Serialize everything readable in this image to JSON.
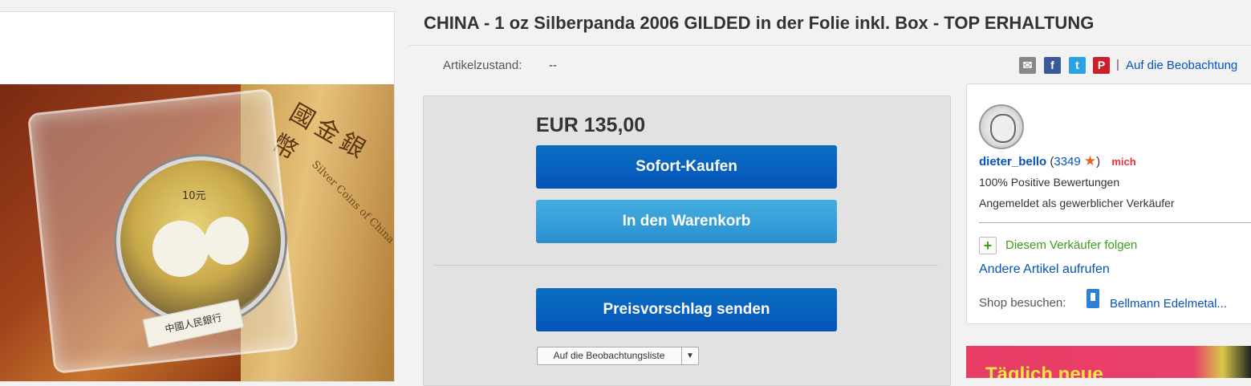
{
  "product": {
    "title": "CHINA - 1 oz Silberpanda 2006 GILDED in der Folie inkl. Box - TOP ERHALTUNG",
    "condition_label": "Artikelzustand:",
    "condition_value": "--",
    "image_box_chars": "國金銀幣",
    "image_box_sub": "Silver Coins of China",
    "image_coin_denom": "10元",
    "image_card_text": "中國人民銀行"
  },
  "share": {
    "separator": "|",
    "watchlist_link": "Auf die Beobachtung"
  },
  "buy_box": {
    "price": "EUR 135,00",
    "buy_now": "Sofort-Kaufen",
    "add_to_cart": "In den Warenkorb",
    "make_offer": "Preisvorschlag senden",
    "watchlist_button": "Auf die Beobachtungsliste"
  },
  "seller": {
    "name": "dieter_bello",
    "score_open": " (",
    "score": "3349",
    "score_close": ")",
    "me_badge_prefix": "m",
    "me_badge_suffix": "ich",
    "positive": "100% Positive Bewertungen",
    "registered": "Angemeldet als gewerblicher Verkäufer",
    "follow": "Diesem Verkäufer folgen",
    "other_items": "Andere Artikel aufrufen",
    "shop_label": "Shop besuchen:",
    "shop_name": "Bellmann Edelmetal..."
  },
  "ad": {
    "text": "Täglich neue"
  },
  "colors": {
    "link": "#0654ba",
    "button_primary": "#0654ba",
    "button_secondary": "#2b8fcf",
    "follow_green": "#3b9d1c",
    "star": "#e8631c"
  }
}
